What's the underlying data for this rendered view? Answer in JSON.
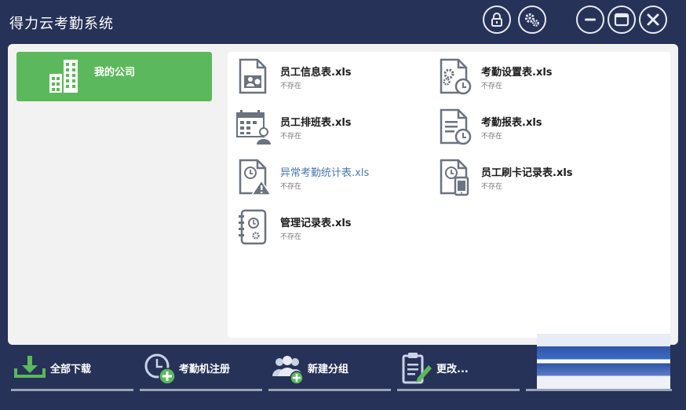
{
  "window": {
    "title": "得力云考勤系统",
    "buttons": [
      {
        "name": "lock",
        "icon": "lock-icon"
      },
      {
        "name": "settings",
        "icon": "gear-icon"
      },
      {
        "name": "minimize",
        "icon": "minus-icon"
      },
      {
        "name": "maximize",
        "icon": "maximize-icon"
      },
      {
        "name": "close",
        "icon": "close-icon"
      }
    ]
  },
  "sidebar": {
    "company": {
      "label": "我的公司",
      "icon": "buildings-icon",
      "color": "#5cb85c"
    }
  },
  "files": [
    {
      "name": "员工信息表.xls",
      "status": "不存在",
      "icon": "employee-info-icon"
    },
    {
      "name": "考勤设置表.xls",
      "status": "不存在",
      "icon": "attendance-settings-icon"
    },
    {
      "name": "员工排班表.xls",
      "status": "不存在",
      "icon": "schedule-icon"
    },
    {
      "name": "考勤报表.xls",
      "status": "不存在",
      "icon": "attendance-report-icon"
    },
    {
      "name": "异常考勤统计表.xls",
      "status": "不存在",
      "icon": "abnormal-attendance-icon",
      "highlight_color": "#4a78b0"
    },
    {
      "name": "员工刷卡记录表.xls",
      "status": "不存在",
      "icon": "card-record-icon"
    },
    {
      "name": "管理记录表.xls",
      "status": "不存在",
      "icon": "management-record-icon"
    }
  ],
  "toolbar": {
    "buttons": [
      {
        "label": "全部下载",
        "icon": "download-icon"
      },
      {
        "label": "考勤机注册",
        "icon": "clock-add-icon"
      },
      {
        "label": "新建分组",
        "icon": "group-add-icon"
      },
      {
        "label": "更改...",
        "icon": "edit-clipboard-icon"
      }
    ]
  },
  "colors": {
    "background": "#263257",
    "panel": "#f2f2f2",
    "accent_green": "#5cb85c",
    "icon_gray": "#6b7280"
  }
}
